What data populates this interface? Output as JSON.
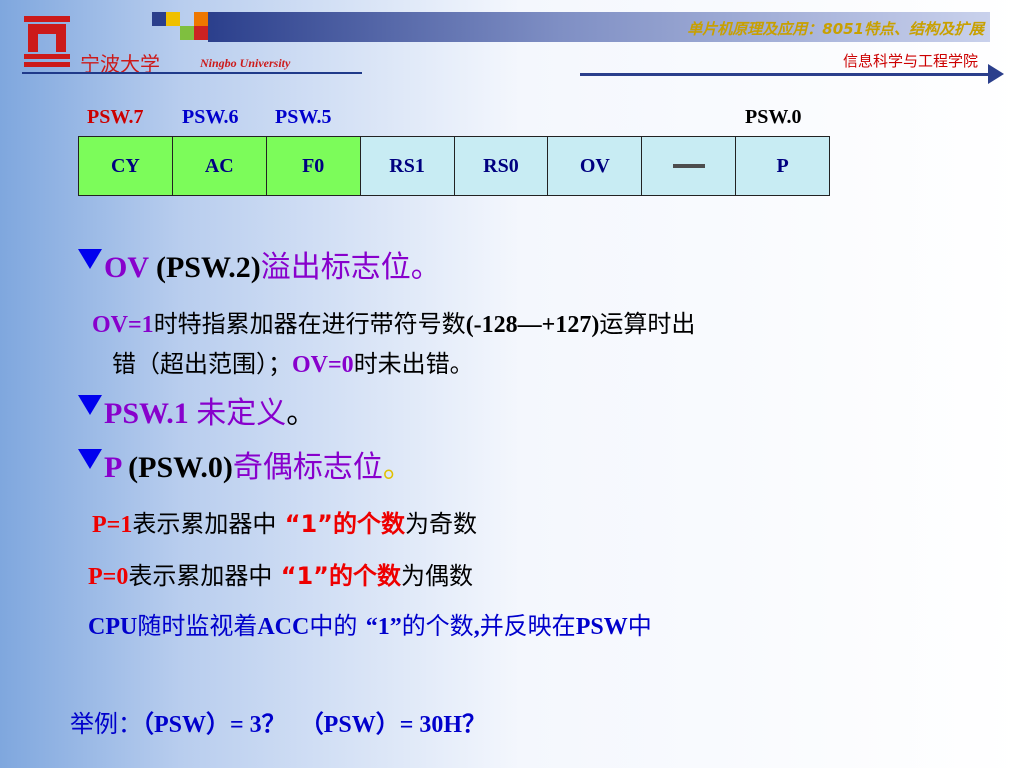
{
  "header": {
    "university_cn": "宁波大学",
    "university_en": "Ningbo University",
    "course_title": "单片机原理及应用：8051特点、结构及扩展",
    "department": "信息科学与工程学院"
  },
  "bit_labels": {
    "psw7": "PSW.7",
    "psw6": "PSW.6",
    "psw5": "PSW.5",
    "psw0": "PSW.0"
  },
  "psw_bits": [
    {
      "label": "CY"
    },
    {
      "label": "AC"
    },
    {
      "label": "F0"
    },
    {
      "label": "RS1"
    },
    {
      "label": "RS0"
    },
    {
      "label": "OV"
    },
    {
      "label": ""
    },
    {
      "label": "P"
    }
  ],
  "ov_bullet": {
    "name": "OV",
    "reg": " (PSW.2)",
    "desc": "溢出标志位。",
    "line1_a": "OV=1",
    "line1_b": "时特指累加器在进行带符号数",
    "line1_c": "(-128—+127)",
    "line1_d": "运算时出",
    "line2_a": "错（超出范围）；",
    "line2_b": "OV=0",
    "line2_c": "时未出错。"
  },
  "psw1_bullet": {
    "name": "PSW.1 ",
    "desc": "未定义",
    "tail": "。"
  },
  "p_bullet": {
    "name": "P",
    "reg": " (PSW.0)",
    "desc": "奇偶标志位",
    "tail": "。",
    "p1_a": "P=1",
    "p1_b": "表示累加器中",
    "p1_c": "“1”的个数",
    "p1_d": "为奇数",
    "p0_a": "P=0",
    "p0_b": "表示累加器中",
    "p0_c": "“1”的个数",
    "p0_d": "为偶数",
    "cpu_a": "CPU",
    "cpu_b": "随时监视着",
    "cpu_c": "ACC",
    "cpu_d": "中的",
    "cpu_e": "“1”",
    "cpu_f": "的个数",
    "cpu_g": ",",
    "cpu_h": "并反映在",
    "cpu_i": "PSW",
    "cpu_j": "中"
  },
  "example": {
    "label": "举例：",
    "q1": "（PSW）= 3？",
    "q2": "（PSW）= 30H？"
  },
  "colors": {
    "accent_blue": "#0000cc",
    "purple": "#8800cc",
    "red": "#ee0000",
    "header_bar": "#2b3f8c",
    "cell_green": "#7cfc5a",
    "cell_cyan": "#c8ecf3"
  }
}
